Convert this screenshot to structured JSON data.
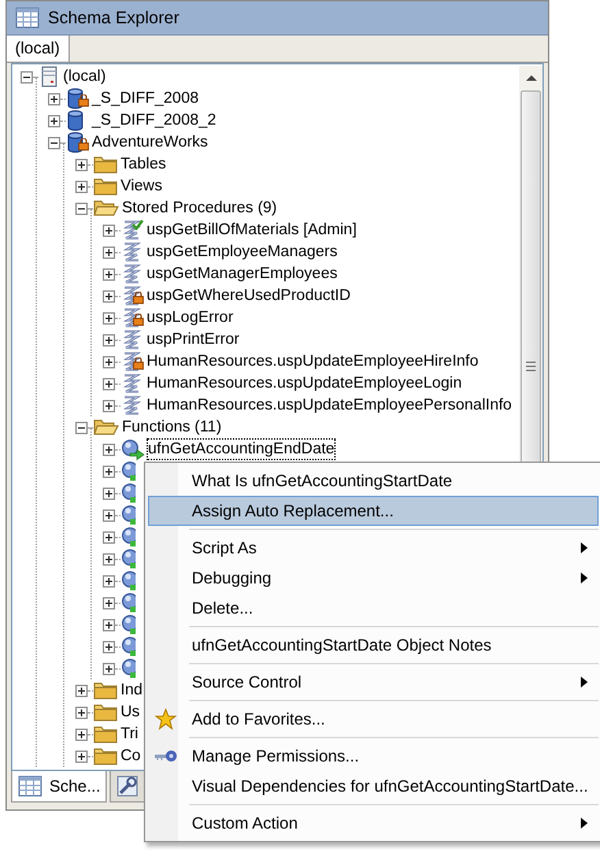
{
  "window": {
    "title": "Schema Explorer"
  },
  "tabs": [
    {
      "label": "(local)",
      "selected": true
    }
  ],
  "tree": [
    {
      "label": "(local)",
      "kind": "server",
      "expanded": true,
      "focused": false,
      "children": [
        {
          "label": "_S_DIFF_2008",
          "kind": "database",
          "locked": true,
          "expanded": false,
          "focused": false
        },
        {
          "label": "_S_DIFF_2008_2",
          "kind": "database",
          "locked": false,
          "expanded": false,
          "focused": false
        },
        {
          "label": "AdventureWorks",
          "kind": "database",
          "locked": true,
          "expanded": true,
          "focused": false,
          "children": [
            {
              "label": "Tables",
              "kind": "folder",
              "expanded": false,
              "focused": false
            },
            {
              "label": "Views",
              "kind": "folder",
              "expanded": false,
              "focused": false
            },
            {
              "label": "Stored Procedures (9)",
              "kind": "folder",
              "expanded": true,
              "focused": false,
              "children": [
                {
                  "label": "uspGetBillOfMaterials [Admin]",
                  "kind": "procedure",
                  "locked": false,
                  "approved": true,
                  "expanded": false,
                  "focused": false
                },
                {
                  "label": "uspGetEmployeeManagers",
                  "kind": "procedure",
                  "locked": false,
                  "approved": false,
                  "expanded": false,
                  "focused": false
                },
                {
                  "label": "uspGetManagerEmployees",
                  "kind": "procedure",
                  "locked": false,
                  "approved": false,
                  "expanded": false,
                  "focused": false
                },
                {
                  "label": "uspGetWhereUsedProductID",
                  "kind": "procedure",
                  "locked": true,
                  "approved": false,
                  "expanded": false,
                  "focused": false
                },
                {
                  "label": "uspLogError",
                  "kind": "procedure",
                  "locked": true,
                  "approved": false,
                  "expanded": false,
                  "focused": false
                },
                {
                  "label": "uspPrintError",
                  "kind": "procedure",
                  "locked": false,
                  "approved": false,
                  "expanded": false,
                  "focused": false
                },
                {
                  "label": "HumanResources.uspUpdateEmployeeHireInfo",
                  "kind": "procedure",
                  "locked": true,
                  "approved": false,
                  "expanded": false,
                  "focused": false
                },
                {
                  "label": "HumanResources.uspUpdateEmployeeLogin",
                  "kind": "procedure",
                  "locked": false,
                  "approved": false,
                  "expanded": false,
                  "focused": false
                },
                {
                  "label": "HumanResources.uspUpdateEmployeePersonalInfo",
                  "kind": "procedure",
                  "locked": false,
                  "approved": false,
                  "expanded": false,
                  "focused": false
                }
              ]
            },
            {
              "label": "Functions (11)",
              "kind": "folder",
              "expanded": true,
              "focused": false,
              "children": [
                {
                  "label": "ufnGetAccountingEndDate",
                  "kind": "function",
                  "expanded": false,
                  "focused": true
                },
                {
                  "kind": "function",
                  "expanded": false,
                  "focused": false
                },
                {
                  "kind": "function",
                  "expanded": false,
                  "focused": false
                },
                {
                  "kind": "function",
                  "expanded": false,
                  "focused": false
                },
                {
                  "kind": "function",
                  "expanded": false,
                  "focused": false
                },
                {
                  "kind": "function",
                  "expanded": false,
                  "focused": false
                },
                {
                  "kind": "function",
                  "expanded": false,
                  "focused": false
                },
                {
                  "kind": "function",
                  "expanded": false,
                  "focused": false
                },
                {
                  "kind": "function",
                  "expanded": false,
                  "focused": false
                },
                {
                  "kind": "function",
                  "expanded": false,
                  "focused": false
                },
                {
                  "kind": "function",
                  "expanded": false,
                  "focused": false
                }
              ]
            },
            {
              "label": "Ind",
              "kind": "folder",
              "expanded": false,
              "focused": false
            },
            {
              "label": "Us",
              "kind": "folder",
              "expanded": false,
              "focused": false
            },
            {
              "label": "Tri",
              "kind": "folder",
              "expanded": false,
              "focused": false
            },
            {
              "label": "Co",
              "kind": "folder",
              "expanded": false,
              "focused": false
            }
          ]
        }
      ]
    }
  ],
  "bottom_tabs": [
    {
      "label": "Sche...",
      "kind": "grid",
      "selected": true
    },
    {
      "kind": "tool",
      "selected": false
    }
  ],
  "context_menu": [
    {
      "kind": "plain",
      "label": "What Is ufnGetAccountingStartDate",
      "selected": false,
      "submenu": false
    },
    {
      "kind": "plain",
      "label": "Assign Auto Replacement...",
      "selected": true,
      "submenu": false
    },
    {
      "kind": "separator"
    },
    {
      "kind": "plain",
      "label": "Script As",
      "selected": false,
      "submenu": true
    },
    {
      "kind": "plain",
      "label": "Debugging",
      "selected": false,
      "submenu": true
    },
    {
      "kind": "plain",
      "label": "Delete...",
      "selected": false,
      "submenu": false
    },
    {
      "kind": "separator"
    },
    {
      "kind": "plain",
      "label": "ufnGetAccountingStartDate Object Notes",
      "selected": false,
      "submenu": false
    },
    {
      "kind": "separator"
    },
    {
      "kind": "plain",
      "label": "Source Control",
      "selected": false,
      "submenu": true
    },
    {
      "kind": "separator"
    },
    {
      "kind": "star",
      "label": "Add to Favorites...",
      "selected": false,
      "submenu": false
    },
    {
      "kind": "separator"
    },
    {
      "kind": "key",
      "label": "Manage Permissions...",
      "selected": false,
      "submenu": false
    },
    {
      "kind": "plain",
      "label": "Visual Dependencies for ufnGetAccountingStartDate...",
      "selected": false,
      "submenu": false
    },
    {
      "kind": "separator"
    },
    {
      "kind": "plain",
      "label": "Custom Action",
      "selected": false,
      "submenu": true
    }
  ]
}
